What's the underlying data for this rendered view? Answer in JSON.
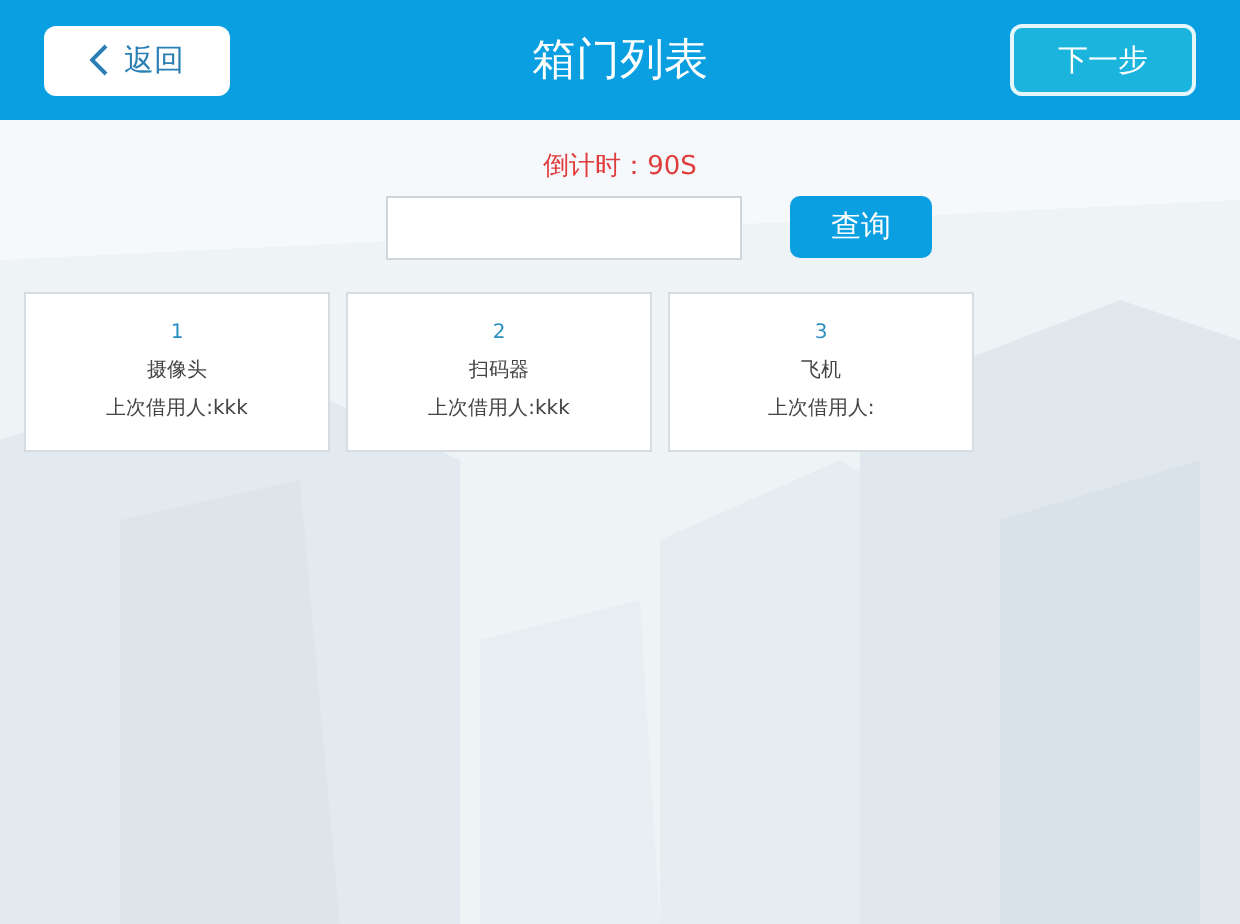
{
  "header": {
    "back_button": "返回",
    "title": "箱门列表",
    "next_button": "下一步"
  },
  "countdown": "倒计时：90S",
  "search": {
    "button": "查询"
  },
  "boxes": [
    {
      "number": "1",
      "name": "摄像头",
      "last_user": "上次借用人:kkk"
    },
    {
      "number": "2",
      "name": "扫码器",
      "last_user": "上次借用人:kkk"
    },
    {
      "number": "3",
      "name": "飞机",
      "last_user": "上次借用人:"
    }
  ]
}
